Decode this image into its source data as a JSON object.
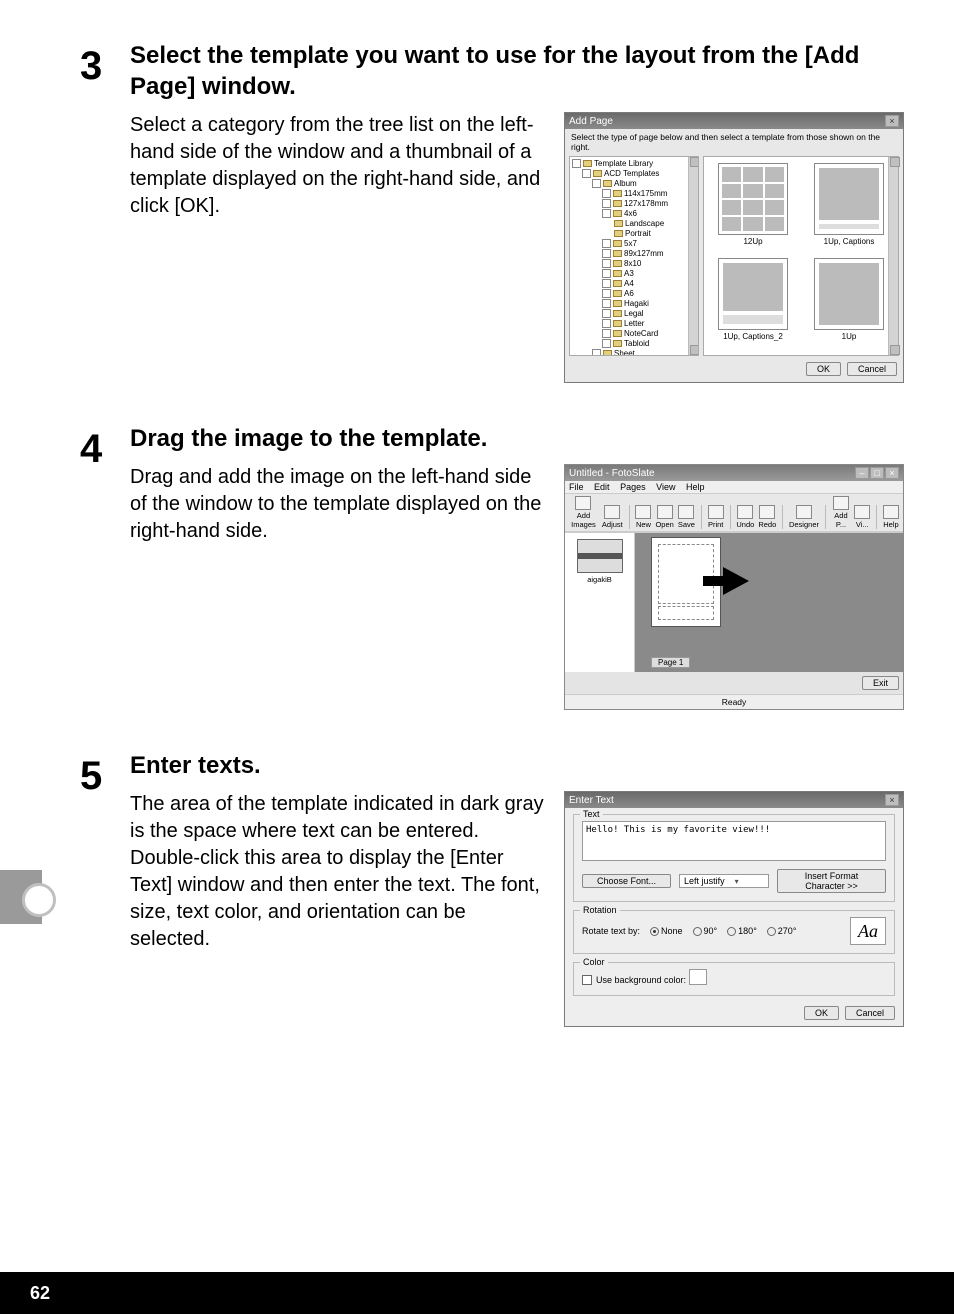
{
  "page_number": "62",
  "steps": {
    "s3": {
      "num": "3",
      "heading": "Select the template you want to use for the layout from the [Add Page] window.",
      "desc": "Select a category from the tree list on the left-hand side of the window and a thumbnail of a template displayed on the right-hand side, and click [OK]."
    },
    "s4": {
      "num": "4",
      "heading": "Drag the image to the template.",
      "desc": "Drag and add the image on the left-hand side of the window to the template displayed on the right-hand side."
    },
    "s5": {
      "num": "5",
      "heading": "Enter texts.",
      "desc": "The area of the template indicated in dark gray is the space where text can be entered. Double-click this area to display the [Enter Text] window and then enter the text. The font, size, text color, and orientation can be selected."
    }
  },
  "addpage": {
    "title": "Add Page",
    "close": "×",
    "instructions": "Select the type of page below and then select a template from those shown on the right.",
    "tree": {
      "root": "Template Library",
      "templates": "ACD Templates",
      "album": "Album",
      "n114": "114x175mm",
      "n127": "127x178mm",
      "n4x6": "4x6",
      "landscape": "Landscape",
      "portrait": "Portrait",
      "n5x7": "5x7",
      "n89": "89x127mm",
      "n8x10": "8x10",
      "a3": "A3",
      "a4": "A4",
      "a6": "A6",
      "hagaki": "Hagaki",
      "legal": "Legal",
      "letter": "Letter",
      "notecard": "NoteCard",
      "tabloid": "Tabloid",
      "sheet": "Sheet"
    },
    "thumbs": {
      "t1": "12Up",
      "t2": "1Up, Captions",
      "t3": "1Up, Captions_2",
      "t4": "1Up"
    },
    "ok": "OK",
    "cancel": "Cancel"
  },
  "fotoslate": {
    "title": "Untitled - FotoSlate",
    "menu": {
      "file": "File",
      "edit": "Edit",
      "pages": "Pages",
      "view": "View",
      "help": "Help"
    },
    "toolbar": {
      "addimages": "Add Images",
      "adjust": "Adjust",
      "new": "New",
      "open": "Open",
      "save": "Save",
      "print": "Print",
      "undo": "Undo",
      "redo": "Redo",
      "designer": "Designer",
      "addp": "Add P...",
      "vi": "Vi...",
      "help": "Help"
    },
    "thumb_label": "aigakiB",
    "page_tab": "Page 1",
    "exit": "Exit",
    "status": "Ready"
  },
  "entertext": {
    "title": "Enter Text",
    "close": "×",
    "legend_text": "Text",
    "sample": "Hello! This is my favorite view!!!",
    "choose_font": "Choose Font...",
    "justify": "Left justify",
    "insert_format": "Insert Format Character >>",
    "legend_rotation": "Rotation",
    "rotate_label": "Rotate text by:",
    "rot_none": "None",
    "rot_90": "90°",
    "rot_180": "180°",
    "rot_270": "270°",
    "preview": "Aa",
    "legend_color": "Color",
    "use_bg": "Use background color:",
    "ok": "OK",
    "cancel": "Cancel"
  }
}
